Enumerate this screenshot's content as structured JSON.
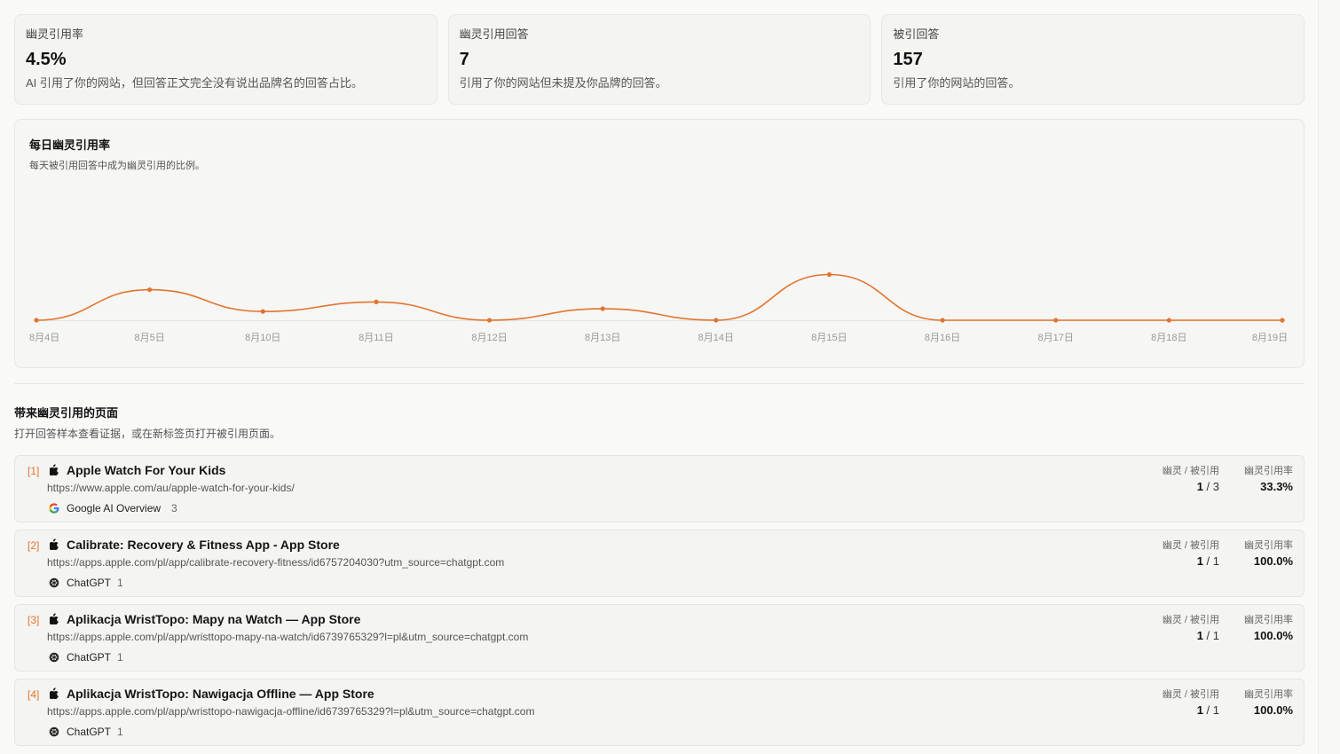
{
  "stats": [
    {
      "label": "幽灵引用率",
      "value": "4.5%",
      "desc": "AI 引用了你的网站，但回答正文完全没有说出品牌名的回答占比。"
    },
    {
      "label": "幽灵引用回答",
      "value": "7",
      "desc": "引用了你的网站但未提及你品牌的回答。"
    },
    {
      "label": "被引回答",
      "value": "157",
      "desc": "引用了你的网站的回答。"
    }
  ],
  "chart_section": {
    "title": "每日幽灵引用率",
    "subtitle": "每天被引用回答中成为幽灵引用的比例。"
  },
  "chart_data": {
    "type": "line",
    "x": [
      "8月4日",
      "8月5日",
      "8月10日",
      "8月11日",
      "8月12日",
      "8月13日",
      "8月14日",
      "8月15日",
      "8月16日",
      "8月17日",
      "8月18日",
      "8月19日"
    ],
    "series": [
      {
        "values": [
          0,
          16.7,
          4.8,
          10.0,
          0,
          6.3,
          0,
          25.0,
          0,
          0,
          0,
          0
        ]
      }
    ],
    "ylim": [
      0,
      100
    ],
    "grid": false,
    "color": "#e2742f"
  },
  "pages_section": {
    "title": "带来幽灵引用的页面",
    "subtitle": "打开回答样本查看证据，或在新标签页打开被引用页面。",
    "col_ratio": "幽灵 / 被引用",
    "col_rate": "幽灵引用率"
  },
  "rows": [
    {
      "idx": "[1]",
      "title": "Apple Watch For Your Kids",
      "url": "https://www.apple.com/au/apple-watch-for-your-kids/",
      "source": "Google AI Overview",
      "source_icon": "google-icon",
      "count": "3",
      "ghost": "1",
      "cited": "3",
      "rate": "33.3%"
    },
    {
      "idx": "[2]",
      "title": "Calibrate: Recovery & Fitness App - App Store",
      "url": "https://apps.apple.com/pl/app/calibrate-recovery-fitness/id6757204030?utm_source=chatgpt.com",
      "source": "ChatGPT",
      "source_icon": "chatgpt-icon",
      "count": "1",
      "ghost": "1",
      "cited": "1",
      "rate": "100.0%"
    },
    {
      "idx": "[3]",
      "title": "Aplikacja WristTopo: Mapy na Watch — App Store",
      "url": "https://apps.apple.com/pl/app/wristtopo-mapy-na-watch/id6739765329?l=pl&utm_source=chatgpt.com",
      "source": "ChatGPT",
      "source_icon": "chatgpt-icon",
      "count": "1",
      "ghost": "1",
      "cited": "1",
      "rate": "100.0%"
    },
    {
      "idx": "[4]",
      "title": "Aplikacja WristTopo: Nawigacja Offline — App Store",
      "url": "https://apps.apple.com/pl/app/wristtopo-nawigacja-offline/id6739765329?l=pl&utm_source=chatgpt.com",
      "source": "ChatGPT",
      "source_icon": "chatgpt-icon",
      "count": "1",
      "ghost": "1",
      "cited": "1",
      "rate": "100.0%"
    }
  ]
}
